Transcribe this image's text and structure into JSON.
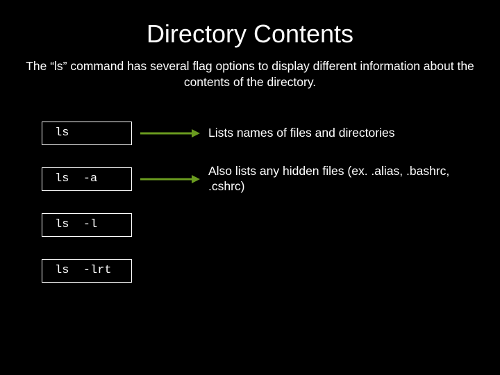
{
  "title": "Directory Contents",
  "subtitle": "The “ls” command has several flag options to display different information about the contents of the directory.",
  "arrow_color": "#6a9b1f",
  "rows": [
    {
      "command": "ls",
      "description": "Lists names of files and directories",
      "show_arrow": true
    },
    {
      "command": "ls  -a",
      "description": "Also lists any hidden files (ex. .alias, .bashrc, .cshrc)",
      "show_arrow": true
    },
    {
      "command": "ls  -l",
      "description": "",
      "show_arrow": false
    },
    {
      "command": "ls  -lrt",
      "description": "",
      "show_arrow": false
    }
  ]
}
